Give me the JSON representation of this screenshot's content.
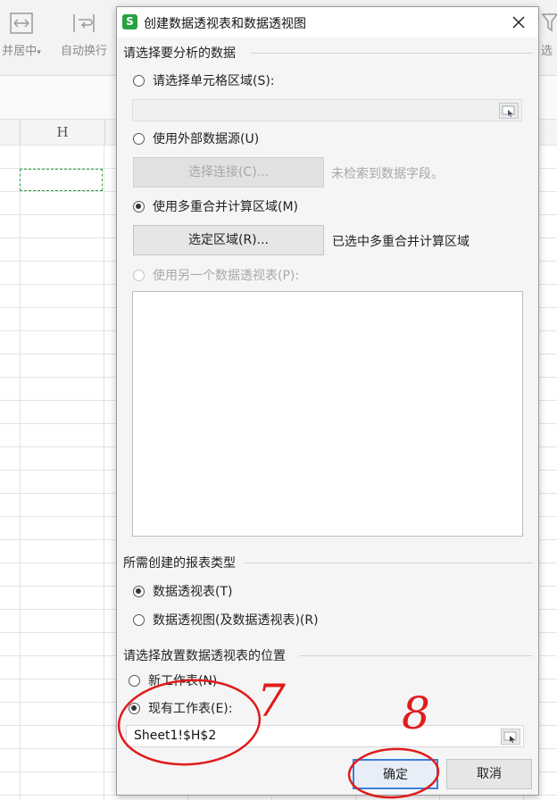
{
  "ribbon": {
    "merge_label": "并居中",
    "wrap_label": "自动换行",
    "right_label": "选"
  },
  "sheet": {
    "column_label": "H"
  },
  "dialog": {
    "title": "创建数据透视表和数据透视图",
    "app_icon_text": "S",
    "section_source": "请选择要分析的数据",
    "opt_range": "请选择单元格区域(S):",
    "opt_external": "使用外部数据源(U)",
    "btn_select_conn": "选择连接(C)...",
    "note_no_fields": "未检索到数据字段。",
    "opt_multi": "使用多重合并计算区域(M)",
    "btn_select_area": "选定区域(R)...",
    "note_multi_selected": "已选中多重合并计算区域",
    "opt_other_pivot": "使用另一个数据透视表(P):",
    "section_report": "所需创建的报表类型",
    "opt_pivot_table": "数据透视表(T)",
    "opt_pivot_chart": "数据透视图(及数据透视表)(R)",
    "section_location": "请选择放置数据透视表的位置",
    "opt_new_sheet": "新工作表(N)",
    "opt_existing_sheet": "现有工作表(E):",
    "location_value": "Sheet1!$H$2",
    "btn_ok": "确定",
    "btn_cancel": "取消"
  },
  "annotations": {
    "step_7": "7",
    "step_8": "8",
    "color": "#e01b1b"
  }
}
